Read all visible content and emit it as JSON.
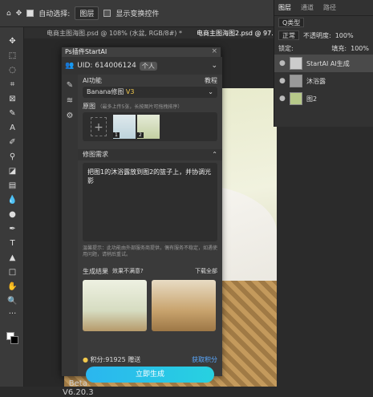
{
  "topbar": {
    "auto_select": "自动选择:",
    "layer": "图层",
    "show_transform": "显示变换控件"
  },
  "tabs": [
    "电商主图海图.psd @ 108% (水盆, RGB/8#) *",
    "电商主图海图2.psd @ 97.6% (StartAI AI生"
  ],
  "layers_panel": {
    "tabs": [
      "图层",
      "通道",
      "路径"
    ],
    "kind": "Q类型",
    "blend": "正常",
    "opacity_label": "不透明度:",
    "opacity": "100%",
    "fill_label": "填充:",
    "fill": "100%",
    "lock_label": "锁定:",
    "layers": [
      "StartAI AI生成",
      "沐浴露",
      "图2"
    ]
  },
  "plugin": {
    "title": "Ps插件StartAI",
    "uid": "UID: 614006124",
    "user_badge": "个人",
    "func_label": "AI功能",
    "tutorial": "教程",
    "model": "Banana修图",
    "version_badge": "V3",
    "source_label": "原图",
    "source_hint": "（最多上传5张，长按图片可拖拽排序）",
    "req_label": "修图需求",
    "prompt": "把图1的沐浴露放到图2的篮子上，并协调光影",
    "tip": "温馨提示：此功能由外部服务商提供，偶有服务不稳定，如遇使用问题，请稍后重试。",
    "result_label": "生成结果",
    "dissatisfied": "效果不满意?",
    "download": "下载全部",
    "points": "积分:91925",
    "gift": "赠送",
    "get_points": "获取积分",
    "generate": "立即生成",
    "version": "Beta V6.20.3"
  }
}
